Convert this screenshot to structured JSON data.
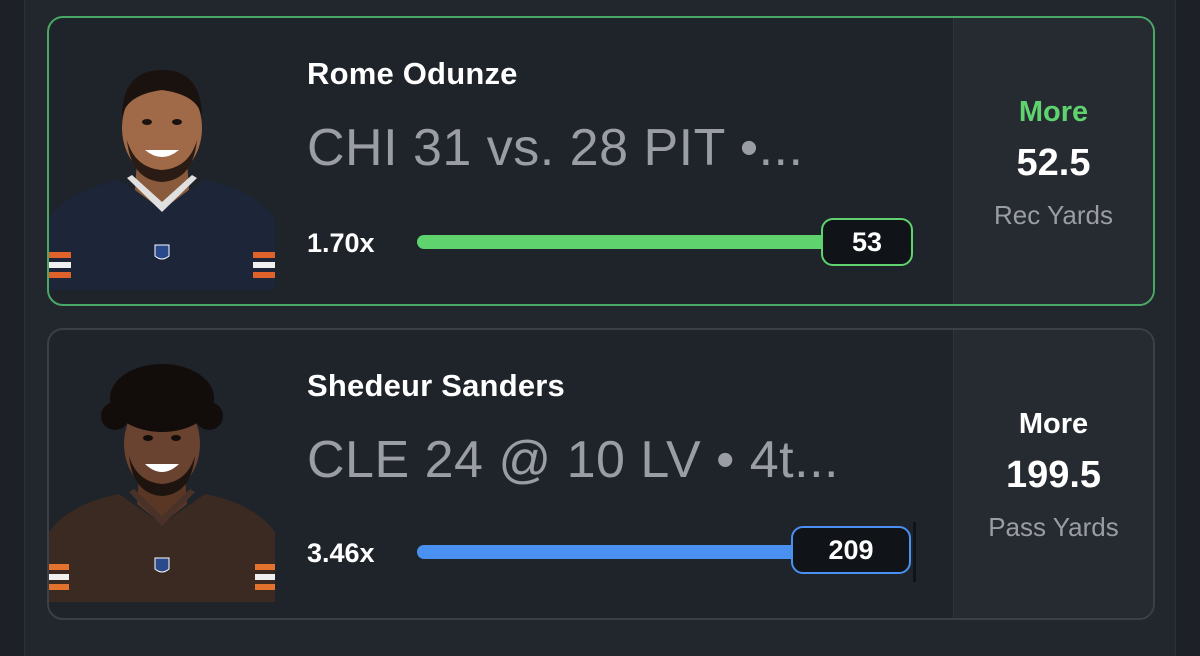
{
  "picks": [
    {
      "player": "Rome Odunze",
      "game": "CHI 31 vs. 28 PIT •...",
      "multiplier": "1.70x",
      "current_value": "53",
      "progress_fraction": 1.0,
      "direction": "More",
      "line": "52.5",
      "stat": "Rec Yards",
      "accent_color": "#5fd36e",
      "jersey_color": "#1c2638",
      "avatar_icon": "player-headshot-bears"
    },
    {
      "player": "Shedeur Sanders",
      "game": "CLE 24 @ 10 LV • 4t...",
      "multiplier": "3.46x",
      "current_value": "209",
      "progress_fraction": 1.0,
      "direction": "More",
      "line": "199.5",
      "stat": "Pass Yards",
      "accent_color": "#4a90f0",
      "jersey_color": "#3a2a22",
      "avatar_icon": "player-headshot-browns"
    }
  ]
}
